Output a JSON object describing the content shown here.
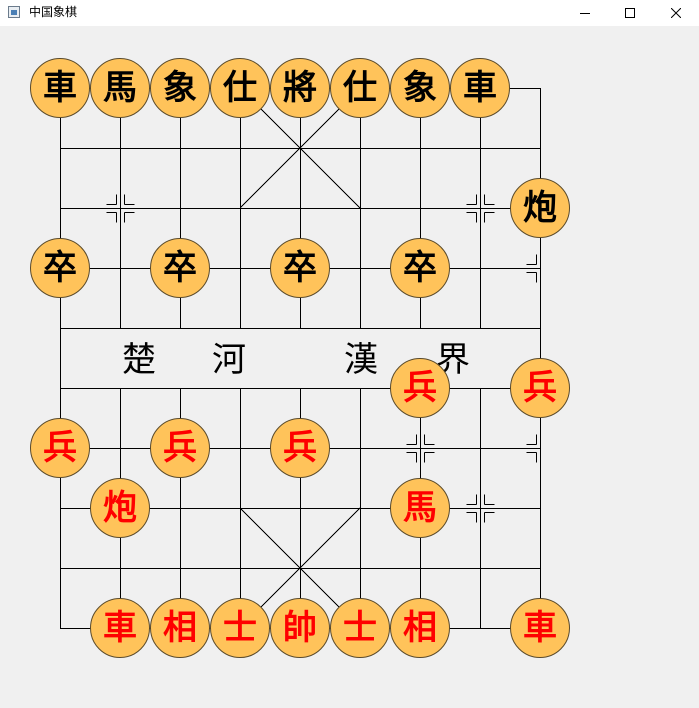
{
  "window": {
    "title": "中国象棋",
    "controls": {
      "minimize": "minimize-icon",
      "maximize": "maximize-icon",
      "close": "close-icon"
    }
  },
  "board": {
    "river_text": [
      "楚",
      "河",
      "漢",
      "界"
    ],
    "pieces": [
      {
        "side": "black",
        "glyph": "車",
        "file": 0,
        "rank": 0
      },
      {
        "side": "black",
        "glyph": "馬",
        "file": 1,
        "rank": 0
      },
      {
        "side": "black",
        "glyph": "象",
        "file": 2,
        "rank": 0
      },
      {
        "side": "black",
        "glyph": "仕",
        "file": 3,
        "rank": 0
      },
      {
        "side": "black",
        "glyph": "將",
        "file": 4,
        "rank": 0
      },
      {
        "side": "black",
        "glyph": "仕",
        "file": 5,
        "rank": 0
      },
      {
        "side": "black",
        "glyph": "象",
        "file": 6,
        "rank": 0
      },
      {
        "side": "black",
        "glyph": "車",
        "file": 7,
        "rank": 0
      },
      {
        "side": "black",
        "glyph": "炮",
        "file": 8,
        "rank": 2
      },
      {
        "side": "black",
        "glyph": "卒",
        "file": 0,
        "rank": 3
      },
      {
        "side": "black",
        "glyph": "卒",
        "file": 2,
        "rank": 3
      },
      {
        "side": "black",
        "glyph": "卒",
        "file": 4,
        "rank": 3
      },
      {
        "side": "black",
        "glyph": "卒",
        "file": 6,
        "rank": 3
      },
      {
        "side": "red",
        "glyph": "兵",
        "file": 6,
        "rank": 5
      },
      {
        "side": "red",
        "glyph": "兵",
        "file": 8,
        "rank": 5
      },
      {
        "side": "red",
        "glyph": "兵",
        "file": 0,
        "rank": 6
      },
      {
        "side": "red",
        "glyph": "兵",
        "file": 2,
        "rank": 6
      },
      {
        "side": "red",
        "glyph": "兵",
        "file": 4,
        "rank": 6
      },
      {
        "side": "red",
        "glyph": "炮",
        "file": 1,
        "rank": 7
      },
      {
        "side": "red",
        "glyph": "馬",
        "file": 6,
        "rank": 7
      },
      {
        "side": "red",
        "glyph": "車",
        "file": 1,
        "rank": 9
      },
      {
        "side": "red",
        "glyph": "相",
        "file": 2,
        "rank": 9
      },
      {
        "side": "red",
        "glyph": "士",
        "file": 3,
        "rank": 9
      },
      {
        "side": "red",
        "glyph": "帥",
        "file": 4,
        "rank": 9
      },
      {
        "side": "red",
        "glyph": "士",
        "file": 5,
        "rank": 9
      },
      {
        "side": "red",
        "glyph": "相",
        "file": 6,
        "rank": 9
      },
      {
        "side": "red",
        "glyph": "車",
        "file": 8,
        "rank": 9
      }
    ],
    "markers": [
      [
        1,
        2
      ],
      [
        7,
        2
      ],
      [
        8,
        3
      ],
      [
        6,
        6
      ],
      [
        8,
        6
      ],
      [
        7,
        7
      ]
    ]
  },
  "colors": {
    "piece_fill": "#ffc35a",
    "red_side": "#ff0000",
    "black_side": "#000000",
    "background": "#f0f0f0"
  }
}
